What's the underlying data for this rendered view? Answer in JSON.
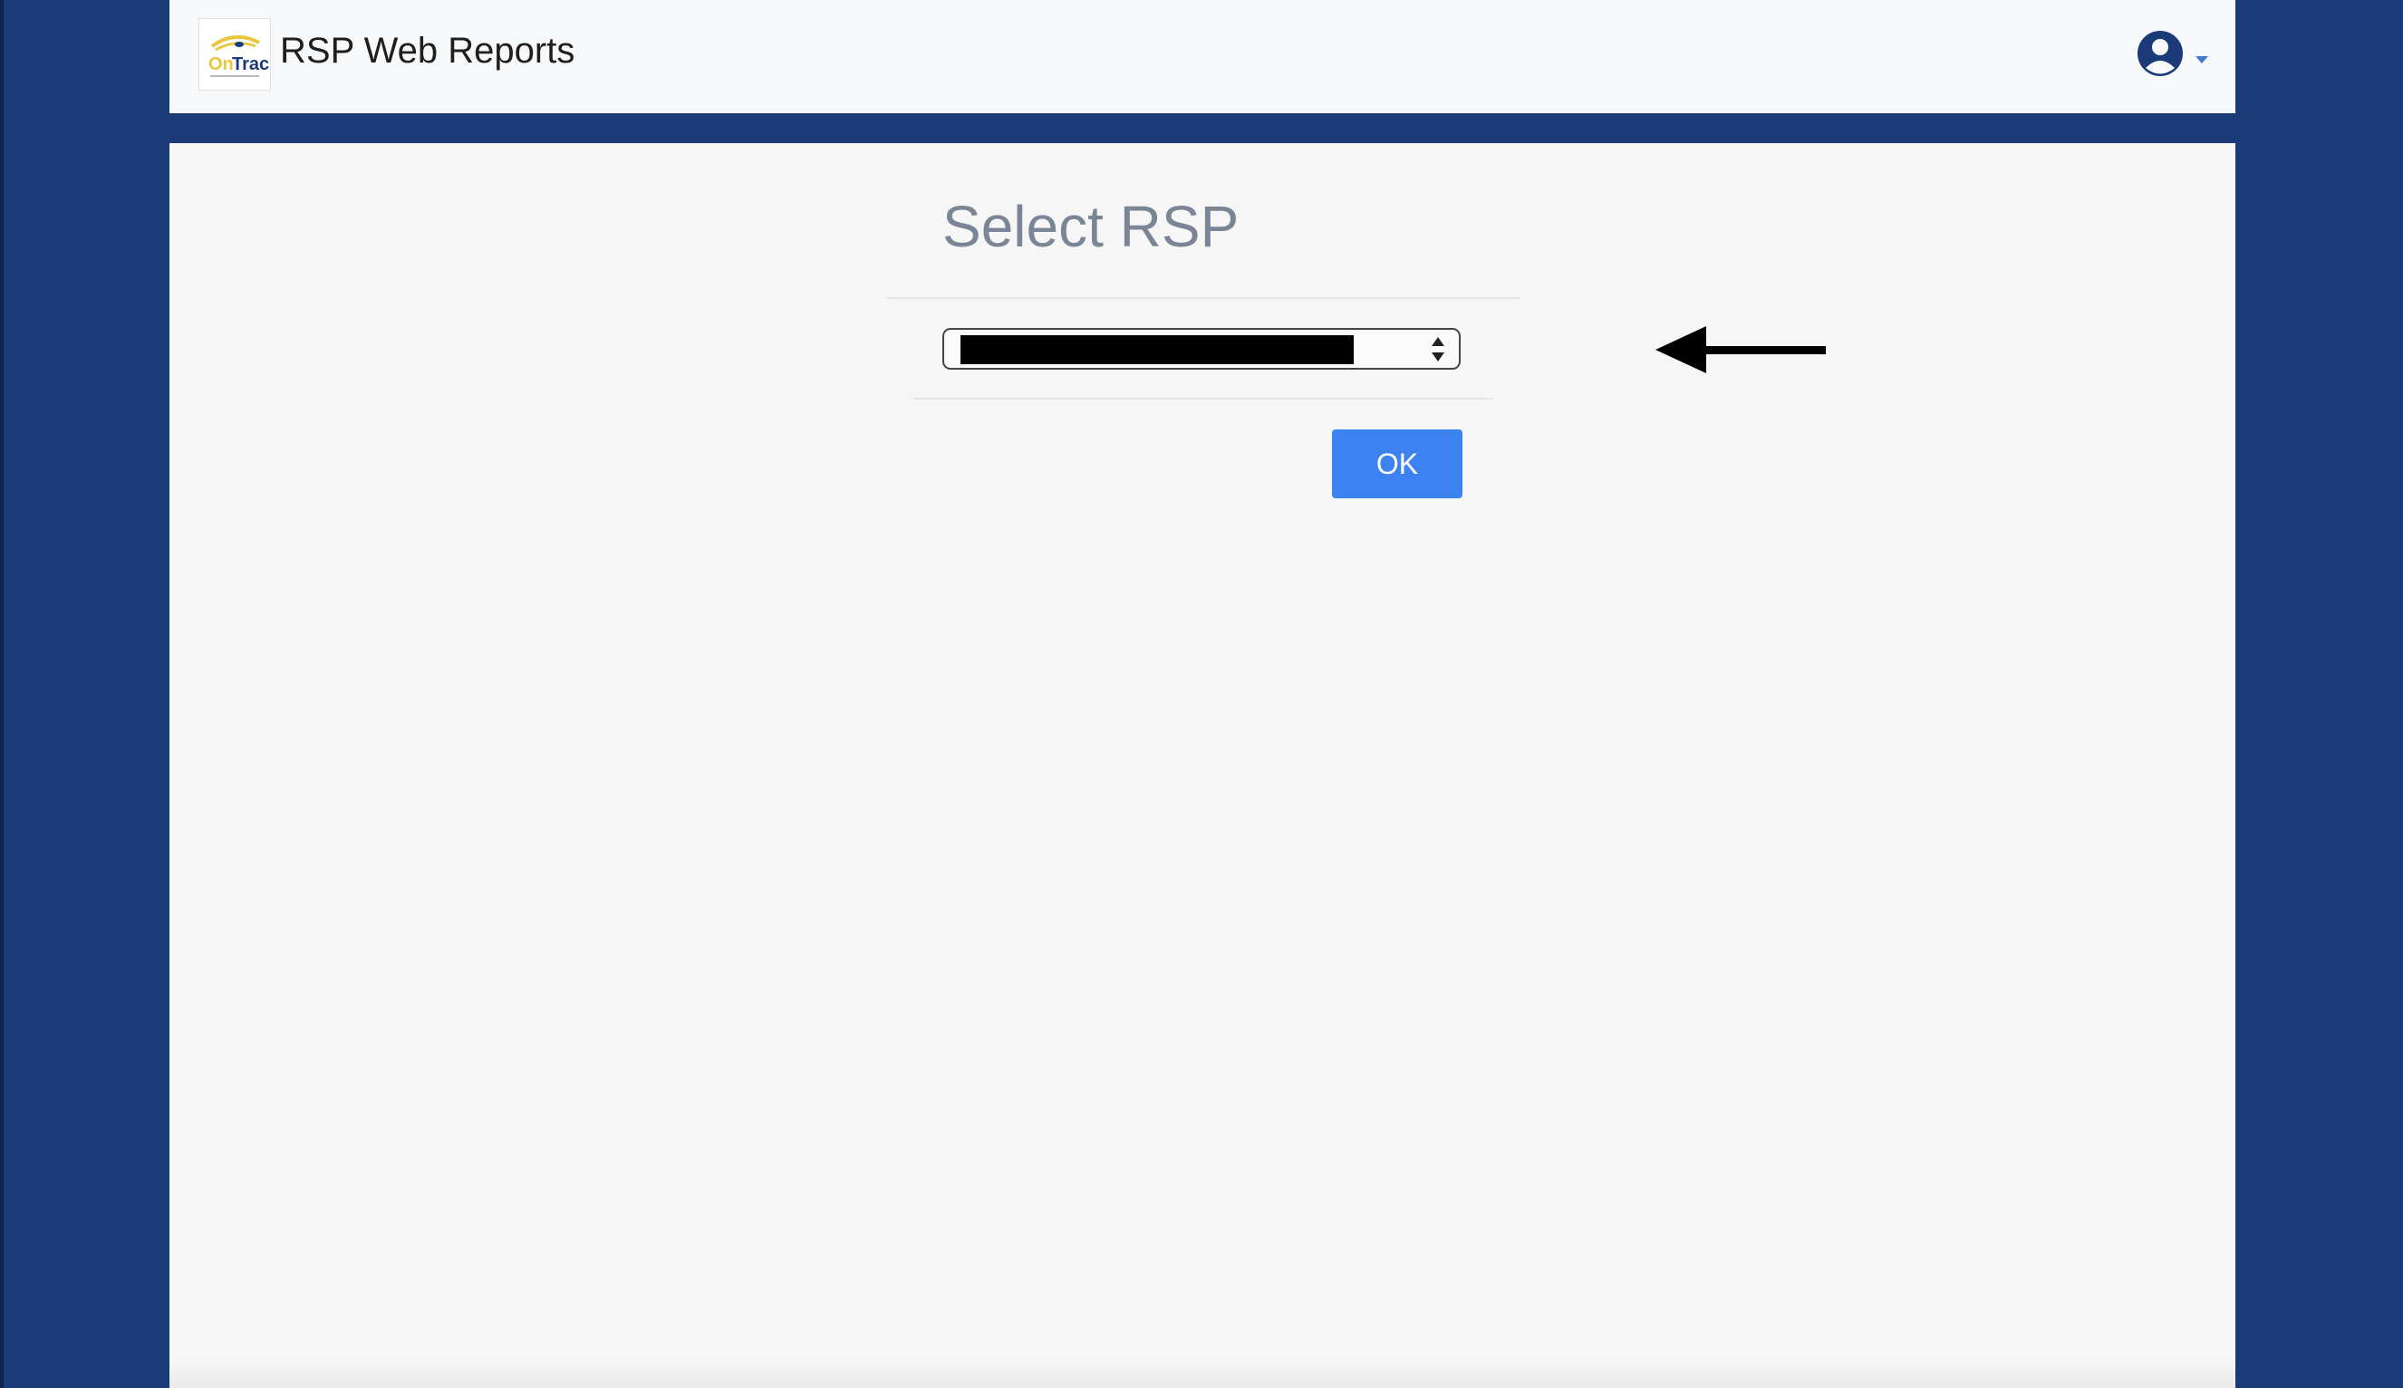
{
  "header": {
    "brand_title": "RSP Web Reports",
    "logo_icon": "ontrac-logo",
    "logo_text": "OnTrac",
    "user_icon": "user-circle-icon"
  },
  "main": {
    "title": "Select RSP",
    "rsp_select": {
      "selected_value": "",
      "redacted": true
    },
    "ok_label": "OK"
  },
  "colors": {
    "background": "#1a3a78",
    "navbar": "#f7f8fa",
    "content": "#f6f6f6",
    "ok_button": "#3c82f0",
    "title_text": "#7a8596"
  }
}
